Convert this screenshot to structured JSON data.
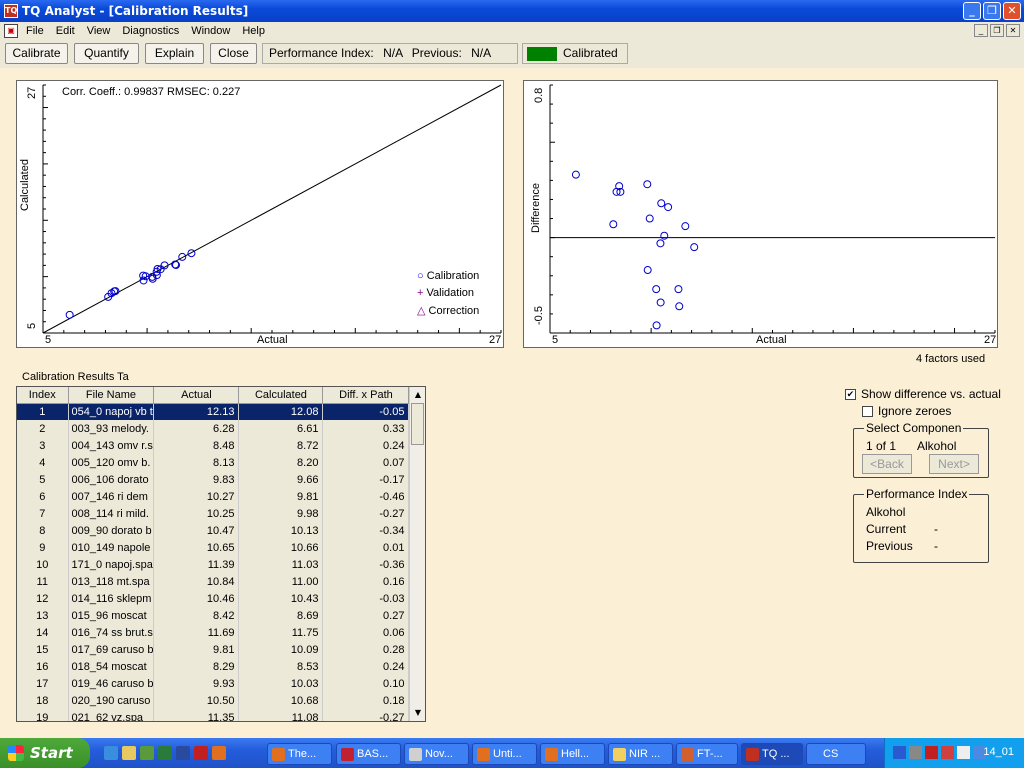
{
  "window": {
    "title": "TQ Analyst  - [Calibration Results]",
    "app_icon": "tq-icon"
  },
  "menu": {
    "items": [
      "File",
      "Edit",
      "View",
      "Diagnostics",
      "Window",
      "Help"
    ]
  },
  "toolbar": {
    "buttons": [
      "Calibrate",
      "Quantify",
      "Explain",
      "Close"
    ],
    "perf_label": "Performance Index:",
    "perf_value": "N/A",
    "previous_label": "Previous:",
    "previous_value": "N/A",
    "status": "Calibrated",
    "status_color": "#008000"
  },
  "plot1": {
    "stats": "Corr. Coeff.: 0.99837   RMSEC: 0.227",
    "xlabel": "Actual",
    "ylabel": "Calculated",
    "x_ticks": [
      "5",
      "27"
    ],
    "y_ticks": [
      "5",
      "27"
    ],
    "legend": [
      "Calibration",
      "Validation",
      "Correction"
    ]
  },
  "plot2": {
    "xlabel": "Actual",
    "ylabel": "Difference",
    "x_ticks": [
      "5",
      "27"
    ],
    "y_ticks": [
      "0.8",
      "-0.5"
    ]
  },
  "factors_used": "4 factors used",
  "table": {
    "caption": "Calibration Results Ta",
    "headers": [
      "Index",
      "File Name",
      "Actual",
      "Calculated",
      "Diff. x Path"
    ],
    "rows": [
      [
        "1",
        "054_0 napoj vb t",
        "12.13",
        "12.08",
        "-0.05"
      ],
      [
        "2",
        "003_93 melody.",
        "6.28",
        "6.61",
        "0.33"
      ],
      [
        "3",
        "004_143 omv r.s",
        "8.48",
        "8.72",
        "0.24"
      ],
      [
        "4",
        "005_120 omv b.",
        "8.13",
        "8.20",
        "0.07"
      ],
      [
        "5",
        "006_106 dorato",
        "9.83",
        "9.66",
        "-0.17"
      ],
      [
        "6",
        "007_146 ri  dem",
        "10.27",
        "9.81",
        "-0.46"
      ],
      [
        "7",
        "008_114 ri mild.",
        "10.25",
        "9.98",
        "-0.27"
      ],
      [
        "8",
        "009_90 dorato b",
        "10.47",
        "10.13",
        "-0.34"
      ],
      [
        "9",
        "010_149 napole",
        "10.65",
        "10.66",
        "0.01"
      ],
      [
        "10",
        "171_0 napoj.spa",
        "11.39",
        "11.03",
        "-0.36"
      ],
      [
        "11",
        "013_118  mt.spa",
        "10.84",
        "11.00",
        "0.16"
      ],
      [
        "12",
        "014_116 sklepm",
        "10.46",
        "10.43",
        "-0.03"
      ],
      [
        "13",
        "015_96  moscat",
        "8.42",
        "8.69",
        "0.27"
      ],
      [
        "14",
        "016_74 ss brut.s",
        "11.69",
        "11.75",
        "0.06"
      ],
      [
        "15",
        "017_69 caruso b",
        "9.81",
        "10.09",
        "0.28"
      ],
      [
        "16",
        "018_54  moscat",
        "8.29",
        "8.53",
        "0.24"
      ],
      [
        "17",
        "019_46 caruso b",
        "9.93",
        "10.03",
        "0.10"
      ],
      [
        "18",
        "020_190  caruso",
        "10.50",
        "10.68",
        "0.18"
      ],
      [
        "19",
        "021_62 vz.spa",
        "11.35",
        "11.08",
        "-0.27"
      ]
    ]
  },
  "options": {
    "show_diff": "Show difference vs. actual",
    "ignore_zeroes": "Ignore zeroes"
  },
  "select_component": {
    "title": "Select Componen",
    "count": "1 of 1",
    "name": "Alkohol",
    "back": "<Back",
    "next": "Next>"
  },
  "perf_index": {
    "title": "Performance Index",
    "component": "Alkohol",
    "current_label": "Current",
    "current_value": "-",
    "previous_label": "Previous",
    "previous_value": "-"
  },
  "taskbar": {
    "start": "Start",
    "tasks": [
      "The...",
      "BAS...",
      "Nov...",
      "Unti...",
      "Hell...",
      "NIR ...",
      "FT-...",
      "TQ ...",
      "CS"
    ],
    "clock": "14_01"
  }
}
